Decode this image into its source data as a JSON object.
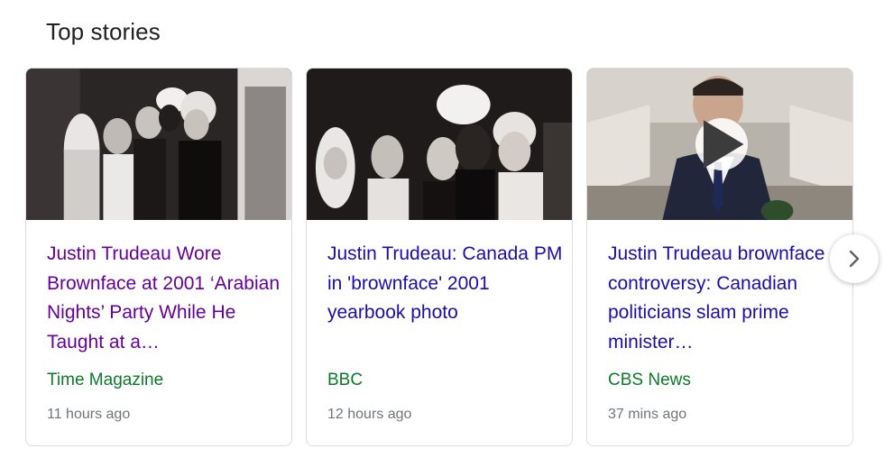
{
  "section": {
    "heading": "Top stories"
  },
  "stories": [
    {
      "title": "Justin Trudeau Wore Brownface at 2001 ‘Arabian Nights’ Party While He Taught at a…",
      "source": "Time Magazine",
      "time": "11 hours ago",
      "visited": true,
      "has_video": false
    },
    {
      "title": "Justin Trudeau: Canada PM in 'brownface' 2001 yearbook photo",
      "source": "BBC",
      "time": "12 hours ago",
      "visited": false,
      "has_video": false
    },
    {
      "title": "Justin Trudeau brownface controversy: Canadian politicians slam prime minister…",
      "source": "CBS News",
      "time": "37 mins ago",
      "visited": false,
      "has_video": true
    }
  ],
  "icons": {
    "play": "play-icon",
    "next": "chevron-right-icon"
  },
  "colors": {
    "visited_link": "#660099",
    "link": "#1a0dab",
    "source": "#0b7a29",
    "meta": "#70757a"
  }
}
